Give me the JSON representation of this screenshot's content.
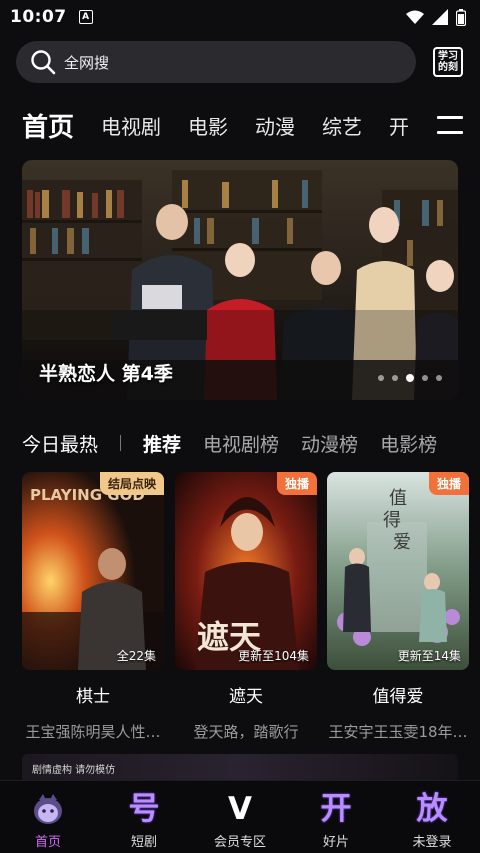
{
  "status": {
    "time": "10:07",
    "notification_badge": "A"
  },
  "search": {
    "label": "全网搜"
  },
  "study_icon": {
    "line1": "学习",
    "line2": "的刻"
  },
  "categories": [
    "首页",
    "电视剧",
    "电影",
    "动漫",
    "综艺",
    "开"
  ],
  "banner": {
    "caption": "半熟恋人 第4季",
    "dots": 5,
    "active_dot": 2
  },
  "rank": {
    "title": "今日最热",
    "tabs": [
      "推荐",
      "电视剧榜",
      "动漫榜",
      "电影榜"
    ]
  },
  "cards": [
    {
      "badge": "结局点映",
      "episodes": "全22集",
      "title": "棋士",
      "subtitle": "王宝强陈明昊人性…"
    },
    {
      "badge": "独播",
      "episodes": "更新至104集",
      "title": "遮天",
      "subtitle": "登天路，踏歌行"
    },
    {
      "badge": "独播",
      "episodes": "更新至14集",
      "title": "值得爱",
      "subtitle": "王安宇王玉雯18年…"
    }
  ],
  "notice": {
    "text": "剧情虚构 请勿模仿"
  },
  "bottom_nav": [
    {
      "glyph": "",
      "label": "首页",
      "active": true
    },
    {
      "glyph": "号",
      "label": "短剧"
    },
    {
      "glyph": "V",
      "label": "会员专区"
    },
    {
      "glyph": "开",
      "label": "好片"
    },
    {
      "glyph": "放",
      "label": "未登录"
    }
  ],
  "colors": {
    "accent": "#d16cff",
    "badge_gold": "#f0c98a",
    "badge_orange": "#f4703a",
    "background": "#0d0d0f"
  }
}
